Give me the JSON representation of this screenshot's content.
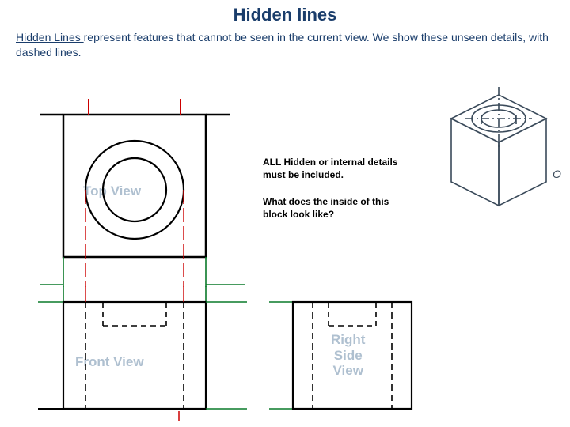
{
  "title": "Hidden lines",
  "desc_lead": "Hidden Lines ",
  "desc_rest": "represent features that cannot be seen in the current view. We show these unseen details, with dashed lines.",
  "note": "ALL Hidden or internal details must be included.",
  "question": "What does the inside of this block look like?",
  "labels": {
    "top": "Top View",
    "front": "Front View",
    "right_l1": "Right",
    "right_l2": "Side",
    "right_l3": "View"
  },
  "iso_label": "O"
}
